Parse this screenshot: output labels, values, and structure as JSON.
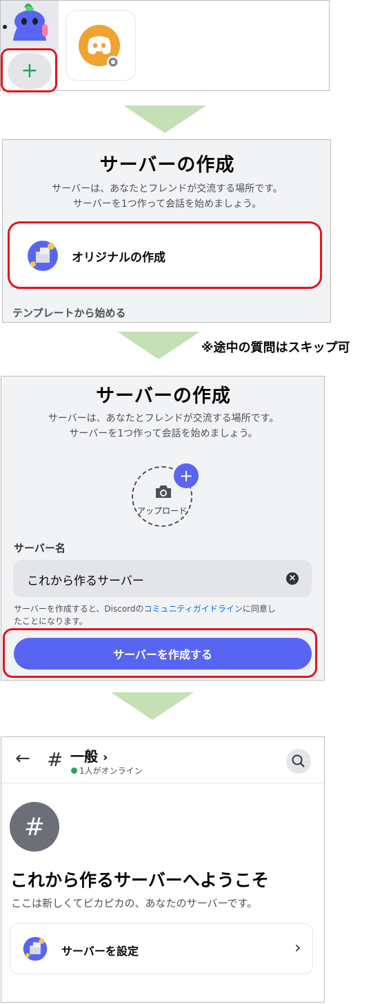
{
  "step1": {
    "add_label": "+"
  },
  "step2": {
    "title": "サーバーの作成",
    "subtitle_line1": "サーバーは、あなたとフレンドが交流する場所です。",
    "subtitle_line2": "サーバーを1つ作って会話を始めましょう。",
    "option_label": "オリジナルの作成",
    "template_label": "テンプレートから始める"
  },
  "note": "※途中の質問はスキップ可",
  "step3": {
    "title": "サーバーの作成",
    "subtitle_line1": "サーバーは、あなたとフレンドが交流する場所です。",
    "subtitle_line2": "サーバーを1つ作って会話を始めましょう。",
    "upload_label": "アップロード",
    "upload_plus": "+",
    "server_name_label": "サーバー名",
    "server_name_value": "これから作るサーバー",
    "clear_icon": "×",
    "terms_prefix": "サーバーを作成すると、Discordの",
    "terms_link": "コミュニティガイドライン",
    "terms_suffix": "に同意し",
    "terms_line2": "たことになります。",
    "create_button": "サーバーを作成する"
  },
  "step4": {
    "back_icon": "←",
    "hash": "#",
    "channel_name": "一般",
    "channel_chevron": "›",
    "online_text": "1人がオンライン",
    "welcome_title": "これから作るサーバーへようこそ",
    "welcome_sub": "ここは新しくてピカピカの、あなたのサーバーです。",
    "setup_label": "サーバーを設定",
    "setup_chevron": "›"
  },
  "colors": {
    "blurple": "#5865f2",
    "red_highlight": "#e4141b",
    "arrow_green": "#c5e0b4",
    "discord_orange": "#f0a232",
    "online_green": "#23a55a",
    "link_blue": "#006ce7"
  }
}
